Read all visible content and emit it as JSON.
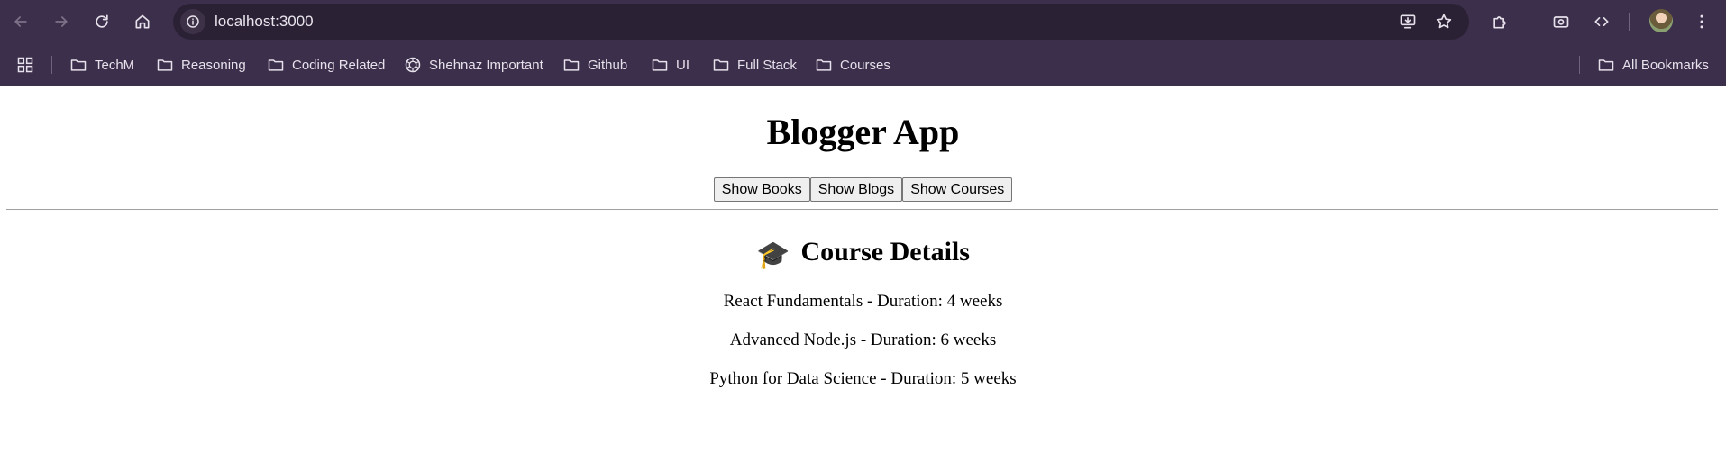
{
  "browser": {
    "url": "localhost:3000",
    "bookmarks": [
      {
        "label": "TechM",
        "icon": "folder-icon"
      },
      {
        "label": "Reasoning",
        "icon": "folder-icon"
      },
      {
        "label": "Coding Related",
        "icon": "folder-icon"
      },
      {
        "label": "Shehnaz Important",
        "icon": "openai-icon"
      },
      {
        "label": "Github",
        "icon": "folder-icon"
      },
      {
        "label": "UI",
        "icon": "folder-icon"
      },
      {
        "label": "Full Stack",
        "icon": "folder-icon"
      },
      {
        "label": "Courses",
        "icon": "folder-icon"
      }
    ],
    "all_bookmarks": "All Bookmarks"
  },
  "app": {
    "title": "Blogger App",
    "buttons": {
      "show_books": "Show Books",
      "show_blogs": "Show Blogs",
      "show_courses": "Show Courses"
    },
    "section": {
      "emoji": "🎓",
      "title": "Course Details"
    },
    "courses": [
      "React Fundamentals - Duration: 4 weeks",
      "Advanced Node.js - Duration: 6 weeks",
      "Python for Data Science - Duration: 5 weeks"
    ]
  },
  "colors": {
    "chrome_bg": "#3c2f4c",
    "omnibox_bg": "#2b2135",
    "chrome_text": "#e6e1ea"
  }
}
